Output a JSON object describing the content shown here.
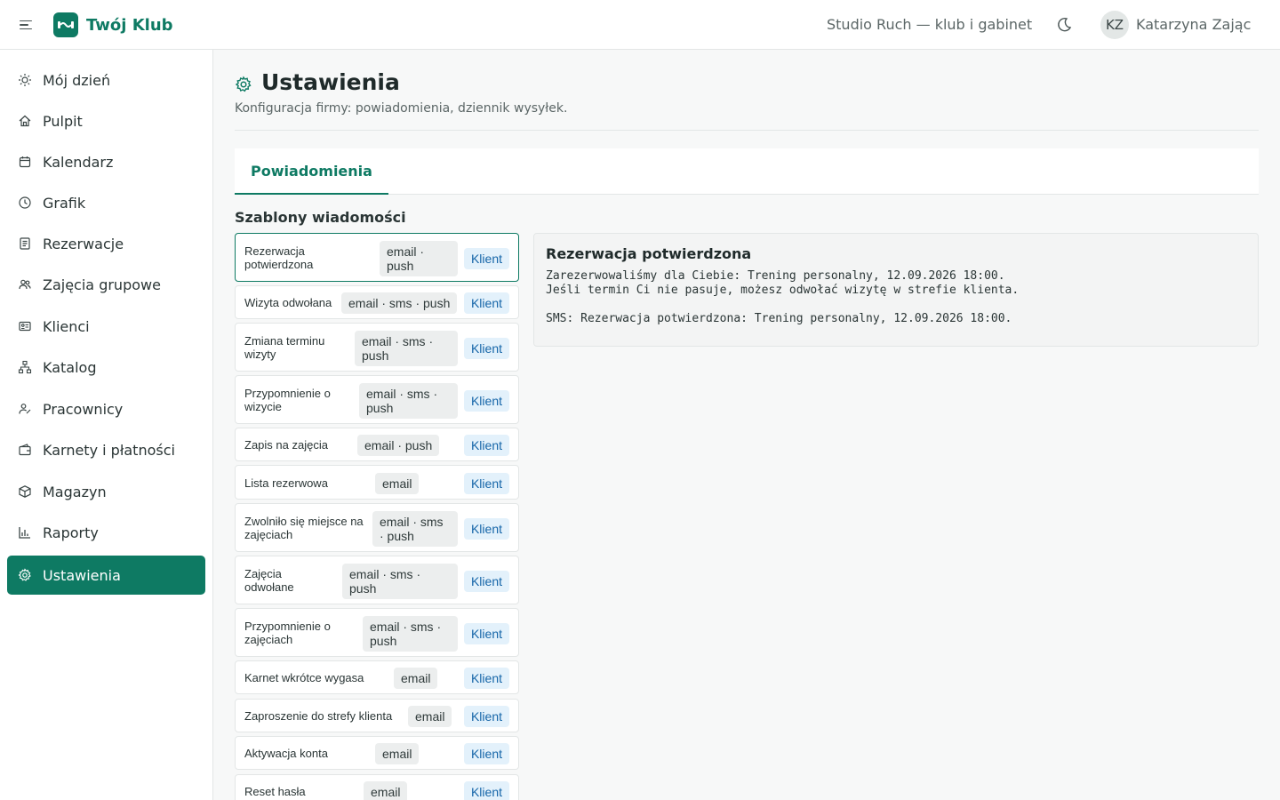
{
  "header": {
    "brand": "Twój Klub",
    "organization": "Studio Ruch — klub i gabinet",
    "user": {
      "initials": "KZ",
      "name": "Katarzyna Zając"
    }
  },
  "sidebar": {
    "items": [
      {
        "label": "Mój dzień",
        "icon": "sun-icon"
      },
      {
        "label": "Pulpit",
        "icon": "home-icon"
      },
      {
        "label": "Kalendarz",
        "icon": "calendar-icon"
      },
      {
        "label": "Grafik",
        "icon": "clock-icon"
      },
      {
        "label": "Rezerwacje",
        "icon": "document-icon"
      },
      {
        "label": "Zajęcia grupowe",
        "icon": "group-icon"
      },
      {
        "label": "Klienci",
        "icon": "id-card-icon"
      },
      {
        "label": "Katalog",
        "icon": "hierarchy-icon"
      },
      {
        "label": "Pracownicy",
        "icon": "staff-icon"
      },
      {
        "label": "Karnety i płatności",
        "icon": "wallet-icon"
      },
      {
        "label": "Magazyn",
        "icon": "box-icon"
      },
      {
        "label": "Raporty",
        "icon": "bar-chart-icon"
      },
      {
        "label": "Ustawienia",
        "icon": "gear-icon",
        "active": true
      }
    ]
  },
  "page": {
    "title": "Ustawienia",
    "subtitle": "Konfiguracja firmy: powiadomienia, dziennik wysyłek.",
    "tabs": [
      {
        "label": "Powiadomienia",
        "active": true
      }
    ]
  },
  "templates": {
    "section_title": "Szablony wiadomości",
    "items": [
      {
        "name": "Rezerwacja potwierdzona",
        "channels": "email · push",
        "audience": "Klient",
        "selected": true
      },
      {
        "name": "Wizyta odwołana",
        "channels": "email · sms · push",
        "audience": "Klient"
      },
      {
        "name": "Zmiana terminu wizyty",
        "channels": "email · sms · push",
        "audience": "Klient"
      },
      {
        "name": "Przypomnienie o wizycie",
        "channels": "email · sms · push",
        "audience": "Klient"
      },
      {
        "name": "Zapis na zajęcia",
        "channels": "email · push",
        "audience": "Klient"
      },
      {
        "name": "Lista rezerwowa",
        "channels": "email",
        "audience": "Klient"
      },
      {
        "name": "Zwolniło się miejsce na zajęciach",
        "channels": "email · sms · push",
        "audience": "Klient"
      },
      {
        "name": "Zajęcia odwołane",
        "channels": "email · sms · push",
        "audience": "Klient"
      },
      {
        "name": "Przypomnienie o zajęciach",
        "channels": "email · sms · push",
        "audience": "Klient"
      },
      {
        "name": "Karnet wkrótce wygasa",
        "channels": "email",
        "audience": "Klient"
      },
      {
        "name": "Zaproszenie do strefy klienta",
        "channels": "email",
        "audience": "Klient"
      },
      {
        "name": "Aktywacja konta",
        "channels": "email",
        "audience": "Klient"
      },
      {
        "name": "Reset hasła",
        "channels": "email",
        "audience": "Klient"
      }
    ]
  },
  "preview": {
    "title": "Rezerwacja potwierdzona",
    "email_line1": "Zarezerwowaliśmy dla Ciebie: Trening personalny, 12.09.2026 18:00.",
    "email_line2": "Jeśli termin Ci nie pasuje, możesz odwołać wizytę w strefie klienta.",
    "sms_line": "SMS: Rezerwacja potwierdzona: Trening personalny, 12.09.2026 18:00."
  },
  "colors": {
    "accent": "#0e7a63",
    "audience_bg": "#e3f1fb",
    "audience_text": "#1565a8",
    "channel_bg": "#eceeee"
  }
}
